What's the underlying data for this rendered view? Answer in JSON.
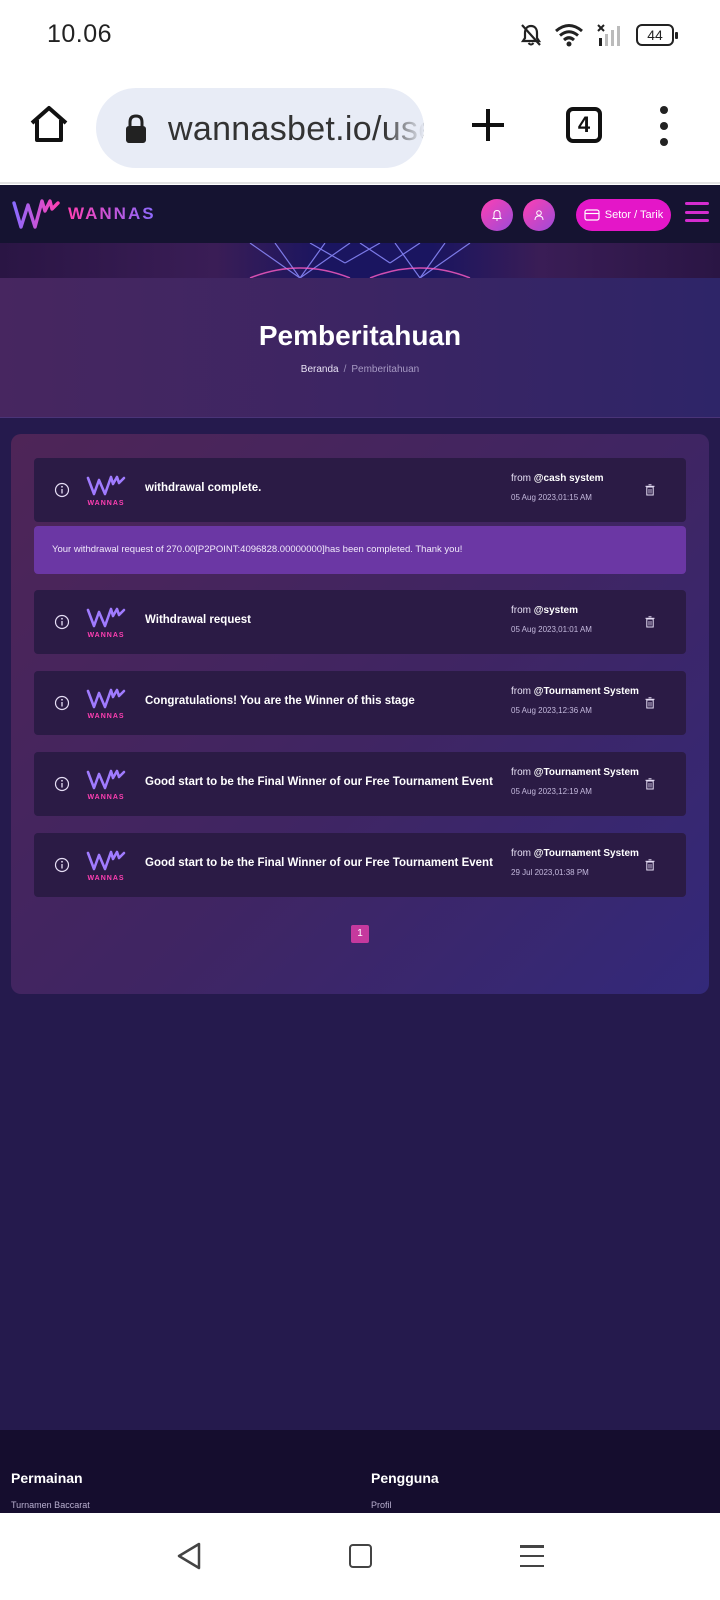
{
  "status_bar": {
    "time": "10.06",
    "battery": "44",
    "icons": [
      "bell-muted-icon",
      "wifi-icon",
      "signal-icon",
      "battery-icon"
    ]
  },
  "browser": {
    "url": "wannasbet.io/user/notification",
    "tab_count": "4",
    "icons": [
      "home-icon",
      "lock-icon",
      "plus-icon",
      "tabs-icon",
      "more-vert-icon"
    ]
  },
  "header": {
    "brand": "WANNAS",
    "deposit_label": "Setor / Tarik",
    "accent_color": "#e416c8"
  },
  "hero": {
    "title": "Pemberitahuan",
    "breadcrumb_home": "Beranda",
    "breadcrumb_separator": "/",
    "breadcrumb_current": "Pemberitahuan"
  },
  "notifications": [
    {
      "title": "withdrawal complete.",
      "from_prefix": "from",
      "sender": "@cash system",
      "date": "05 Aug 2023,01:15 AM",
      "expanded": true,
      "body": "Your withdrawal request of 270.00[P2POINT:4096828.00000000]has been completed. Thank you!"
    },
    {
      "title": "Withdrawal request",
      "from_prefix": "from",
      "sender": "@system",
      "date": "05 Aug 2023,01:01 AM"
    },
    {
      "title": "Congratulations! You are the Winner of this stage",
      "from_prefix": "from",
      "sender": "@Tournament System",
      "date": "05 Aug 2023,12:36 AM"
    },
    {
      "title": "Good start to be the Final Winner of our Free Tournament Event",
      "from_prefix": "from",
      "sender": "@Tournament System",
      "date": "05 Aug 2023,12:19 AM"
    },
    {
      "title": "Good start to be the Final Winner of our Free Tournament Event",
      "from_prefix": "from",
      "sender": "@Tournament System",
      "date": "29 Jul 2023,01:38 PM"
    }
  ],
  "row_logo_text": "WANNAS",
  "pagination": {
    "current": "1"
  },
  "footer": {
    "col1_title": "Permainan",
    "col1_link": "Turnamen Baccarat",
    "col2_title": "Pengguna",
    "col2_link": "Profil"
  }
}
